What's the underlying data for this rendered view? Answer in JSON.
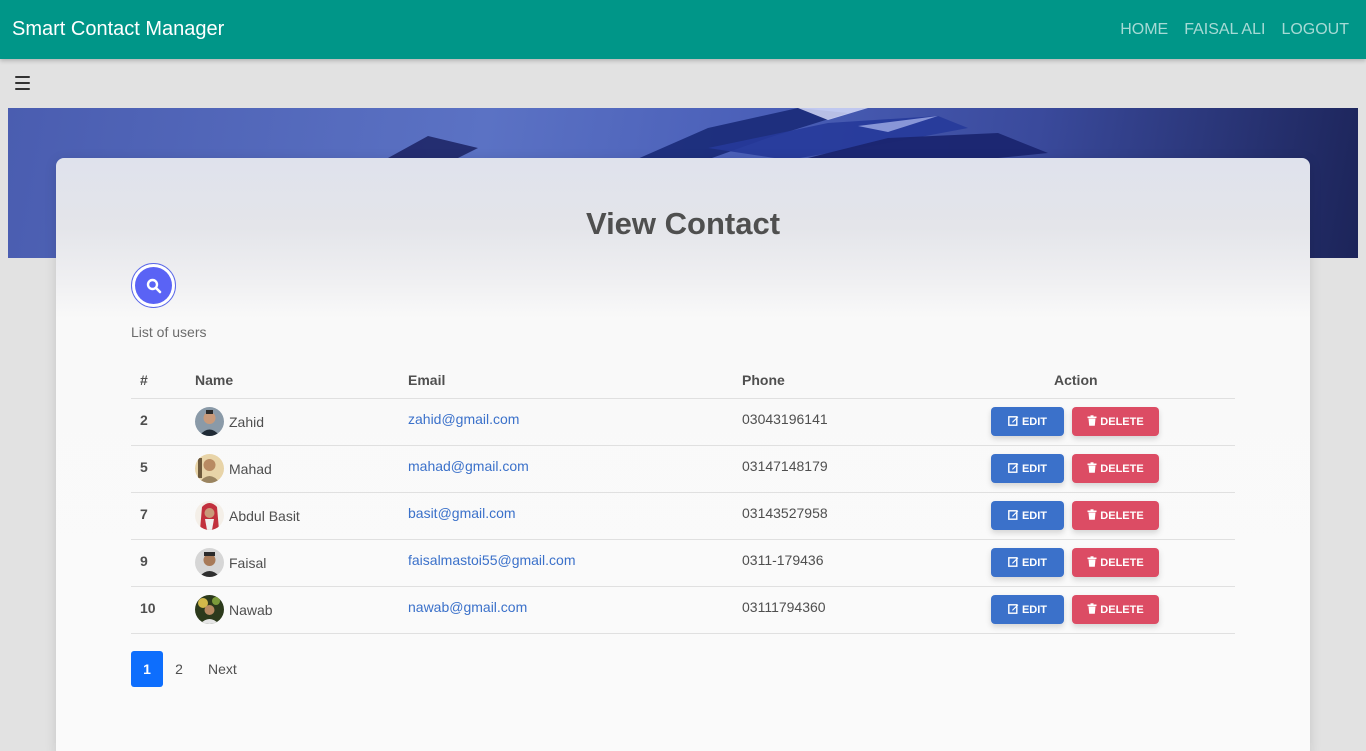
{
  "navbar": {
    "brand": "Smart Contact Manager",
    "links": [
      "HOME",
      "FAISAL ALI",
      "LOGOUT"
    ]
  },
  "page": {
    "title": "View Contact",
    "subtitle": "List of users"
  },
  "table": {
    "headers": [
      "#",
      "Name",
      "Email",
      "Phone",
      "Action"
    ],
    "rows": [
      {
        "id": "2",
        "name": "Zahid",
        "email": "zahid@gmail.com",
        "phone": "03043196141"
      },
      {
        "id": "5",
        "name": "Mahad",
        "email": "mahad@gmail.com",
        "phone": "03147148179"
      },
      {
        "id": "7",
        "name": "Abdul Basit",
        "email": "basit@gmail.com",
        "phone": "03143527958"
      },
      {
        "id": "9",
        "name": "Faisal",
        "email": "faisalmastoi55@gmail.com",
        "phone": "0311-179436"
      },
      {
        "id": "10",
        "name": "Nawab",
        "email": "nawab@gmail.com",
        "phone": "03111794360"
      }
    ],
    "edit_label": "EDIT",
    "delete_label": "DELETE"
  },
  "pagination": {
    "pages": [
      "1",
      "2"
    ],
    "active": "1",
    "next_label": "Next"
  },
  "colors": {
    "navbar": "#009688",
    "link": "#3b71ca",
    "edit": "#3b71ca",
    "delete": "#dc4c64",
    "page_active": "#0d6efd",
    "search": "#5a63f5"
  },
  "icons": {
    "search": "search-icon",
    "menu": "menu-icon",
    "edit": "edit-icon",
    "delete": "trash-icon"
  }
}
